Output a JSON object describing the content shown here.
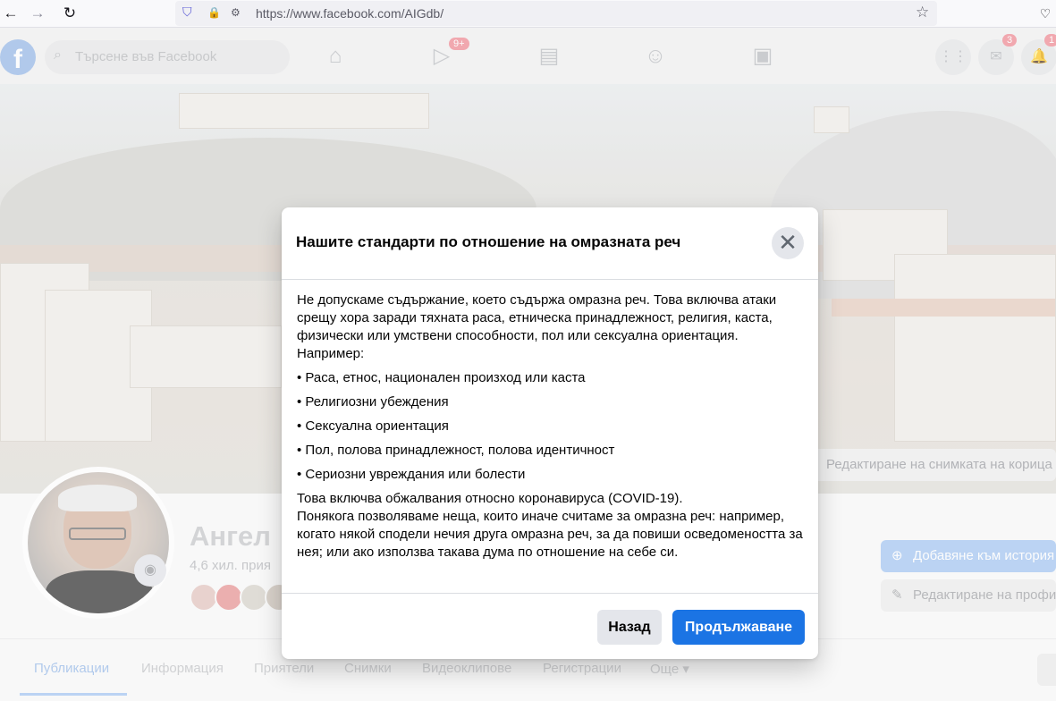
{
  "browser": {
    "url": "https://www.facebook.com/AIGdb/",
    "back_icon": "←",
    "forward_icon": "→",
    "reload_icon": "↻",
    "star_icon": "☆",
    "shield_icon": "⛉",
    "lock_icon": "🔒",
    "pocket_icon": "♡"
  },
  "header": {
    "logo": "f",
    "search_placeholder": "Търсене във Facebook",
    "watch_badge": "9+",
    "messenger_badge": "3",
    "notifications_badge": "1"
  },
  "cover": {
    "edit_label": "Редактиране на снимката на корица"
  },
  "profile": {
    "name": "Ангел",
    "friends": "4,6 хил. прия",
    "add_story_label": "Добавяне към история",
    "edit_profile_label": "Редактиране на профи"
  },
  "tabs": [
    {
      "label": "Публикации"
    },
    {
      "label": "Информация"
    },
    {
      "label": "Приятели"
    },
    {
      "label": "Снимки"
    },
    {
      "label": "Видеоклипове"
    },
    {
      "label": "Регистрации"
    },
    {
      "label": "Още ▾"
    }
  ],
  "modal": {
    "title": "Нашите стандарти по отношение на омразната реч",
    "intro": "Не допускаме съдържание, което съдържа омразна реч. Това включва атаки срещу хора заради тяхната раса, етническа принадлежност, религия, каста, физически или умствени способности, пол или сексуална ориентация.",
    "example_label": "Например:",
    "bullets": [
      "• Раса, етнос, национален произход или каста",
      "• Религиозни убеждения",
      "• Сексуална ориентация",
      "• Пол, полова принадлежност, полова идентичност",
      "• Сериозни увреждания или болести"
    ],
    "covid": "Това включва обжалвания относно коронавируса (COVID-19).",
    "exception": "Понякога позволяваме неща, които иначе считаме за омразна реч: например, когато някой сподели нечия друга омразна реч, за да повиши осведомеността за нея; или ако използва такава дума по отношение на себе си.",
    "back_label": "Назад",
    "continue_label": "Продължаване",
    "close_icon": "✕"
  }
}
